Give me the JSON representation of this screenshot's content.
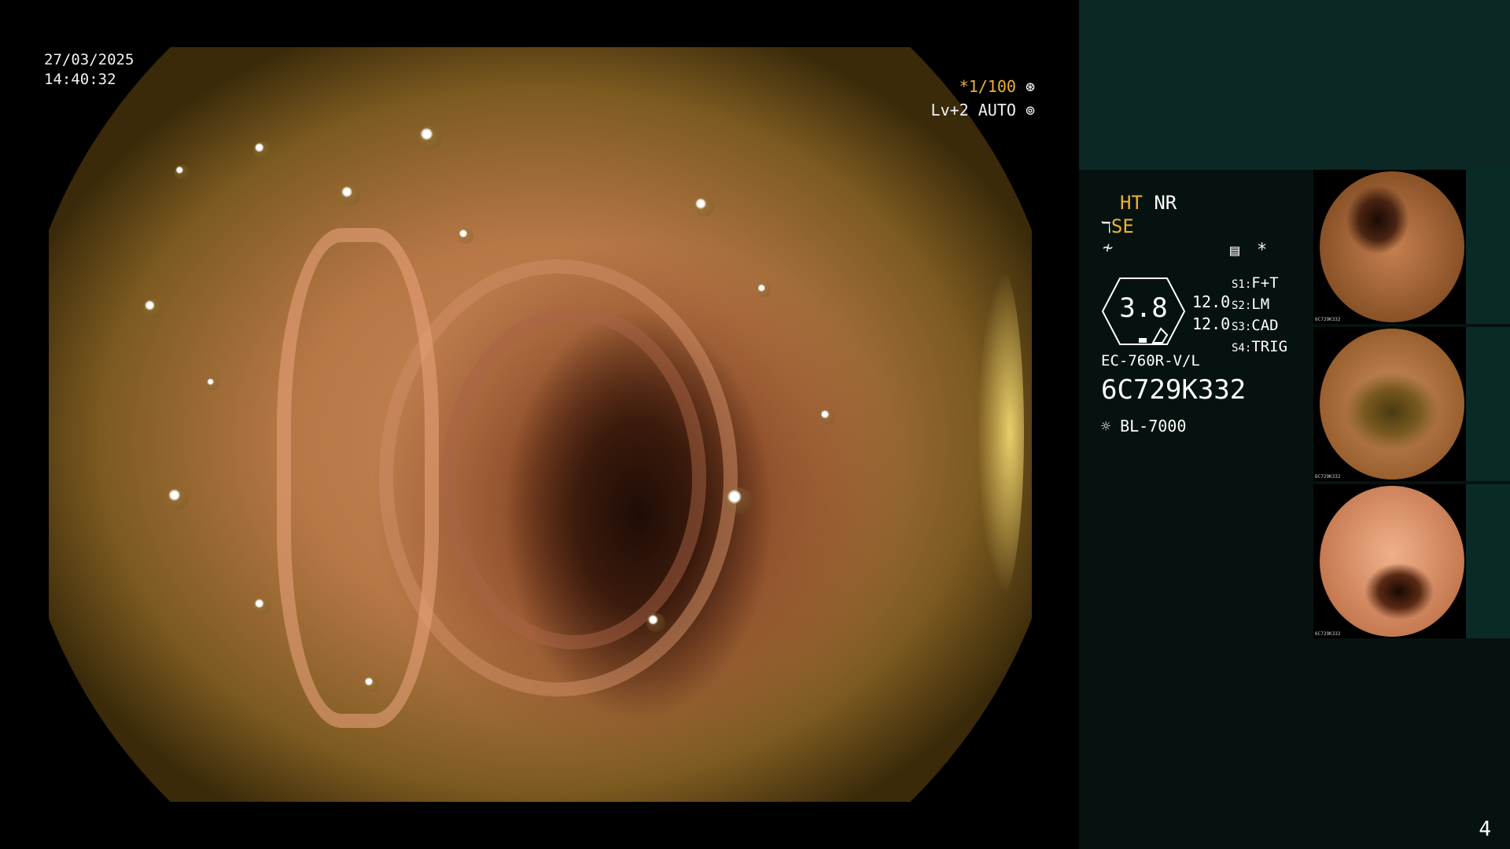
{
  "overlay": {
    "date": "27/03/2025",
    "time": "14:40:32",
    "shutter": "*1/100",
    "shutter_icon": "aperture-icon",
    "level": "Lv+2 AUTO",
    "level_icon": "iris-icon"
  },
  "panel": {
    "ht": "HT",
    "nr": "NR",
    "se": "SE",
    "gauge_value": "3.8",
    "gauge_vals": [
      "12.0",
      "12.0"
    ],
    "switches": [
      {
        "key": "S1:",
        "value": "F+T"
      },
      {
        "key": "S2:",
        "value": "LM"
      },
      {
        "key": "S3:",
        "value": "CAD"
      },
      {
        "key": "S4:",
        "value": "TRIG"
      }
    ],
    "star": "*",
    "scope_model": "EC-760R-V/L",
    "scope_serial": "6C729K332",
    "light_source": "BL-7000",
    "page_number": "4"
  },
  "thumbnails": [
    {
      "caption": "6C729K332"
    },
    {
      "caption": "6C729K332"
    },
    {
      "caption": "6C729K332"
    }
  ]
}
